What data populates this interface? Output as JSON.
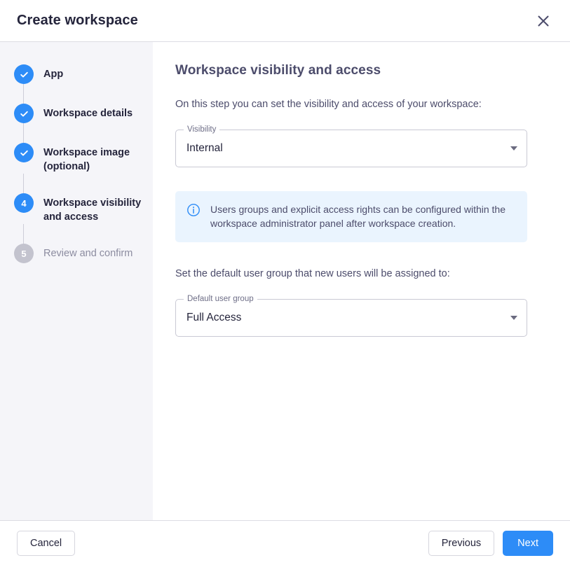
{
  "header": {
    "title": "Create workspace",
    "close_icon": "close-icon"
  },
  "stepper": {
    "steps": [
      {
        "label": "App",
        "state": "done",
        "marker": "check-icon"
      },
      {
        "label": "Workspace details",
        "state": "done",
        "marker": "check-icon"
      },
      {
        "label": "Workspace image (optional)",
        "state": "done",
        "marker": "check-icon"
      },
      {
        "label": "Workspace visibility and access",
        "state": "active",
        "marker": "4"
      },
      {
        "label": "Review and confirm",
        "state": "upcoming",
        "marker": "5"
      }
    ]
  },
  "content": {
    "title": "Workspace visibility and access",
    "intro_text": "On this step you can set the visibility and access of your workspace:",
    "visibility_field": {
      "label": "Visibility",
      "value": "Internal",
      "arrow_icon": "chevron-down-icon"
    },
    "info_banner": {
      "icon": "info-circle-icon",
      "text": "Users groups and explicit access rights can be configured within the workspace administrator panel after workspace creation."
    },
    "default_group_text": "Set the default user group that new users will be assigned to:",
    "default_group_field": {
      "label": "Default user group",
      "value": "Full Access",
      "arrow_icon": "chevron-down-icon"
    }
  },
  "footer": {
    "cancel_label": "Cancel",
    "previous_label": "Previous",
    "next_label": "Next"
  },
  "colors": {
    "accent": "#2d8cf7",
    "sidebar_bg": "#f5f5f9",
    "info_bg": "#eaf4fe",
    "upcoming": "#c3c3ce"
  }
}
